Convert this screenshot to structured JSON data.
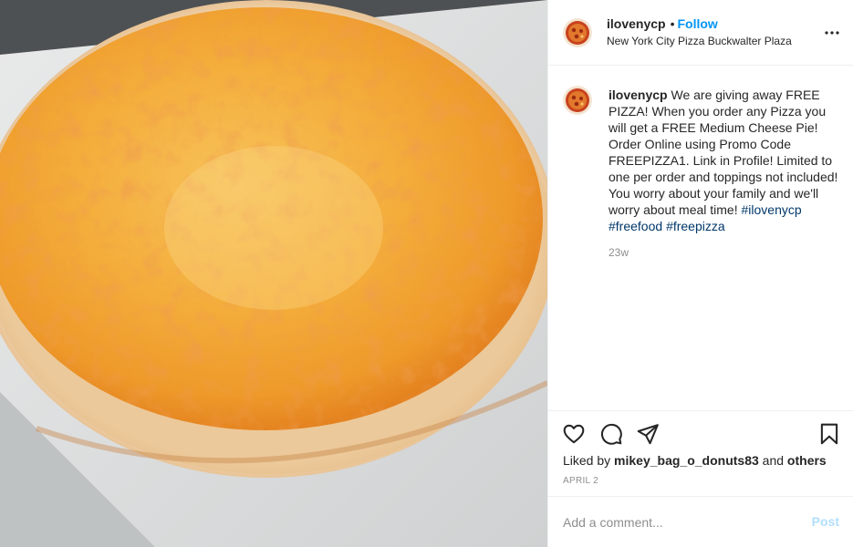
{
  "media": {
    "alt": "Cheese pizza",
    "icon": "pizza-photo"
  },
  "header": {
    "username": "ilovenycp",
    "separator": "•",
    "follow_label": "Follow",
    "location": "New York City Pizza Buckwalter Plaza",
    "more_icon": "more-options-icon"
  },
  "caption": {
    "username": "ilovenycp",
    "text": "We are giving away FREE PIZZA! When you order any Pizza you will get a FREE Medium Cheese Pie! Order Online using Promo Code FREEPIZZA1. Link in Profile! Limited to one per order and toppings not included! You worry about your family and we'll worry about meal time!",
    "hashtags": [
      "#ilovenycp",
      "#freefood",
      "#freepizza"
    ],
    "time_ago": "23w"
  },
  "actions": {
    "icons": [
      "heart-icon",
      "comment-icon",
      "share-icon",
      "bookmark-icon"
    ],
    "liked_by_prefix": "Liked by",
    "liked_by_user": "mikey_bag_o_donuts83",
    "liked_by_and": "and",
    "liked_by_others": "others",
    "date": "APRIL 2"
  },
  "comment": {
    "placeholder": "Add a comment...",
    "post_label": "Post"
  },
  "colors": {
    "link_blue": "#0095f6",
    "hashtag_blue": "#00376b",
    "muted": "#8e8e8e",
    "post_disabled": "#b2dffc"
  }
}
